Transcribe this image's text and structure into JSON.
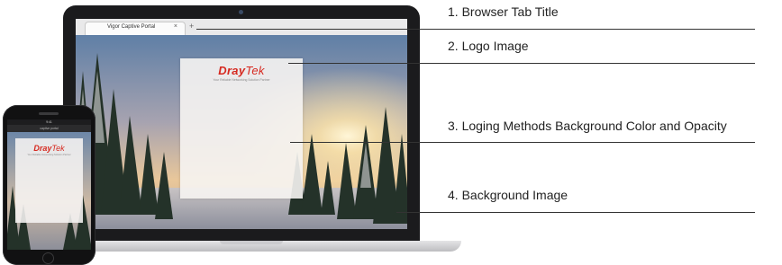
{
  "browser": {
    "tab_title": "Vigor Captive Portal",
    "tab_close": "×",
    "new_tab": "+"
  },
  "login_panel": {
    "logo_part1": "Dray",
    "logo_part2": "Tek",
    "slogan": "Your Reliable Networking Solution Partner"
  },
  "phone": {
    "status_text": "9:41",
    "url_text": "captive portal",
    "logo_part1": "Dray",
    "logo_part2": "Tek",
    "slogan": "Your Reliable Networking Solution Partner"
  },
  "callouts": [
    {
      "label": "1. Browser Tab Title"
    },
    {
      "label": "2. Logo Image"
    },
    {
      "label": "3. Loging Methods Background Color and Opacity"
    },
    {
      "label": "4. Background Image"
    }
  ],
  "colors": {
    "brand_red": "#d6281f",
    "callout_line": "#333333"
  }
}
